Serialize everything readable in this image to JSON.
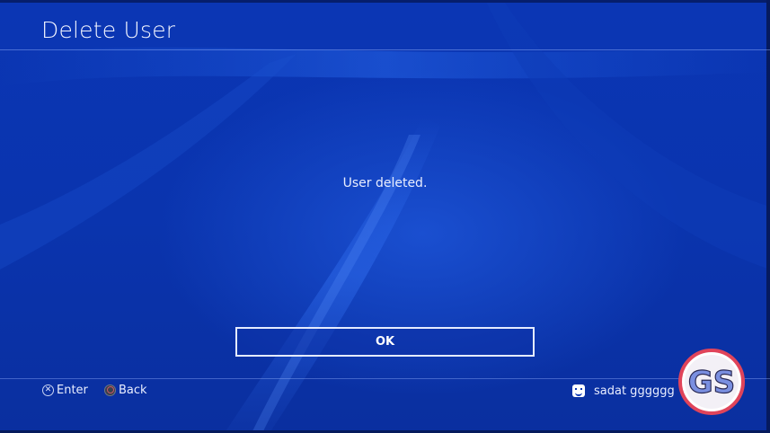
{
  "header": {
    "title": "Delete User"
  },
  "dialog": {
    "message": "User deleted.",
    "ok_label": "OK"
  },
  "footer": {
    "hints": [
      {
        "icon": "cross-button-icon",
        "label": "Enter"
      },
      {
        "icon": "circle-button-icon",
        "label": "Back"
      }
    ],
    "user": {
      "icon": "smiley-avatar-icon",
      "name": "sadat gggggg"
    }
  },
  "watermark": {
    "text": "GS",
    "colors": {
      "ring": "#e0445a",
      "fill": "#ffffff",
      "text": "#7a8fe0"
    }
  },
  "colors": {
    "background": "#0b36b4",
    "text": "#ffffff",
    "divider": "#96b4ff"
  }
}
